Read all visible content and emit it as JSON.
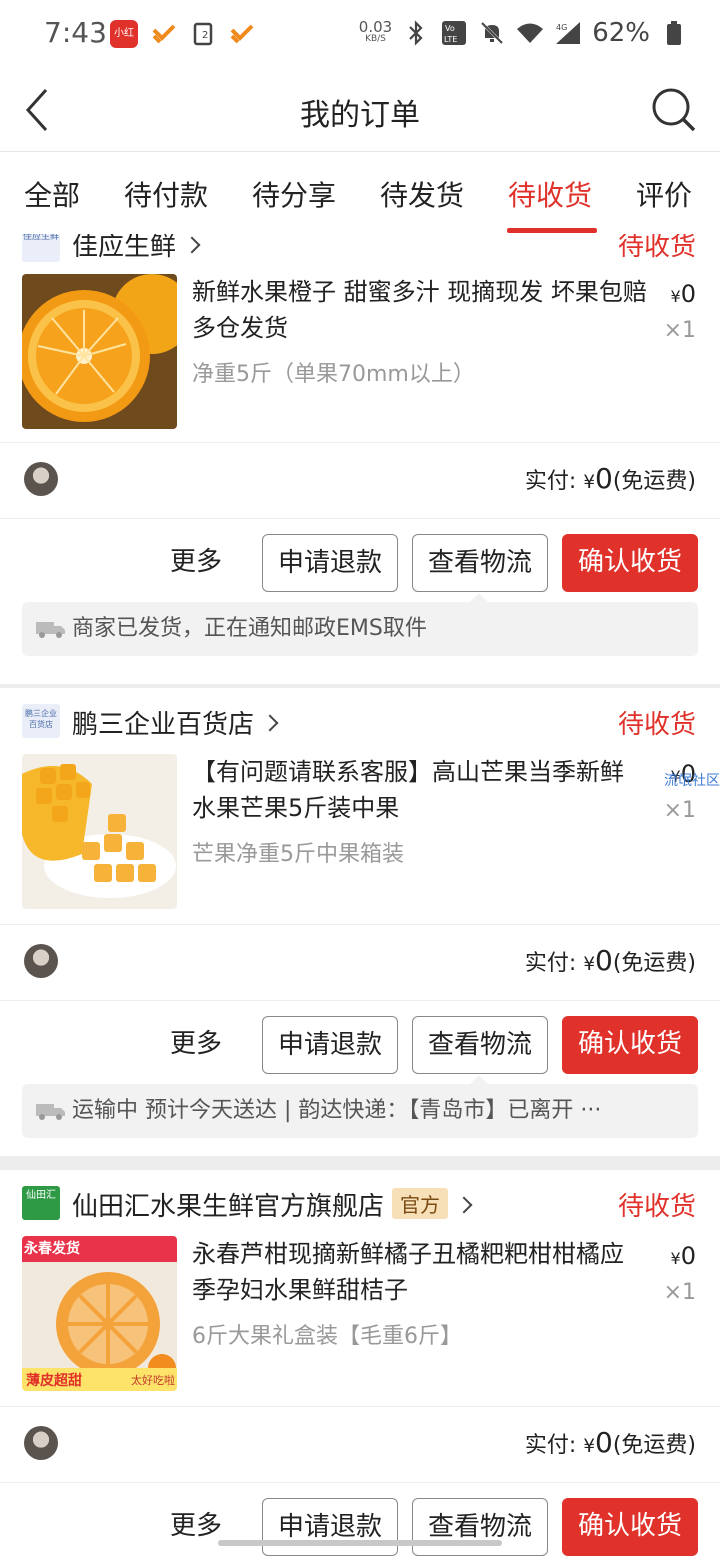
{
  "status_bar": {
    "time": "7:43",
    "app_icon_label": "小红书",
    "speed_value": "0.03",
    "speed_unit": "KB/S",
    "volte": "Vo LTE",
    "network": "4G",
    "battery": "62%"
  },
  "nav": {
    "title": "我的订单"
  },
  "tabs": [
    {
      "label": "全部"
    },
    {
      "label": "待付款"
    },
    {
      "label": "待分享"
    },
    {
      "label": "待发货"
    },
    {
      "label": "待收货"
    },
    {
      "label": "评价"
    }
  ],
  "active_tab": "待收货",
  "orders": [
    {
      "shop_logo": "佳应生鲜",
      "shop_name": "佳应生鲜",
      "status": "待收货",
      "product_title": "新鲜水果橙子 甜蜜多汁 现摘现发 坏果包赔多仓发货",
      "spec": "净重5斤（单果70mm以上）",
      "price_symbol": "¥",
      "price": "0",
      "qty": "×1",
      "paid_label": "实付:",
      "paid_symbol": "¥",
      "paid_amount": "0",
      "shipping": "(免运费)",
      "buttons": {
        "more": "更多",
        "refund": "申请退款",
        "logistics": "查看物流",
        "confirm": "确认收货"
      },
      "logistics_text": "商家已发货，正在通知邮政EMS取件"
    },
    {
      "shop_logo": "鹏三企业百货店",
      "shop_name": "鹏三企业百货店",
      "status": "待收货",
      "product_title": "【有问题请联系客服】高山芒果当季新鲜水果芒果5斤装中果",
      "spec": "芒果净重5斤中果箱装",
      "price_symbol": "¥",
      "price": "0",
      "qty": "×1",
      "paid_label": "实付:",
      "paid_symbol": "¥",
      "paid_amount": "0",
      "shipping": "(免运费)",
      "buttons": {
        "more": "更多",
        "refund": "申请退款",
        "logistics": "查看物流",
        "confirm": "确认收货"
      },
      "logistics_text": "运输中 预计今天送达 | 韵达快递：【青岛市】已离开 ···"
    },
    {
      "shop_logo": "仙田汇",
      "shop_name": "仙田汇水果生鲜官方旗舰店",
      "official_badge": "官方",
      "status": "待收货",
      "product_title": "永春芦柑现摘新鲜橘子丑橘粑粑柑柑橘应季孕妇水果鲜甜桔子",
      "spec": "6斤大果礼盒装【毛重6斤】",
      "price_symbol": "¥",
      "price": "0",
      "qty": "×1",
      "img_text_top": "永春发货",
      "img_text_bottom": "薄皮超甜",
      "img_text_corner": "太好吃啦",
      "paid_label": "实付:",
      "paid_symbol": "¥",
      "paid_amount": "0",
      "shipping": "(免运费)",
      "buttons": {
        "more": "更多",
        "refund": "申请退款",
        "logistics": "查看物流",
        "confirm": "确认收货"
      }
    }
  ],
  "side_overlay": "流氓社区",
  "colors": {
    "accent": "#e0312a",
    "official_bg": "#f7e0b8",
    "logistics_bg": "#f2f2f2"
  }
}
